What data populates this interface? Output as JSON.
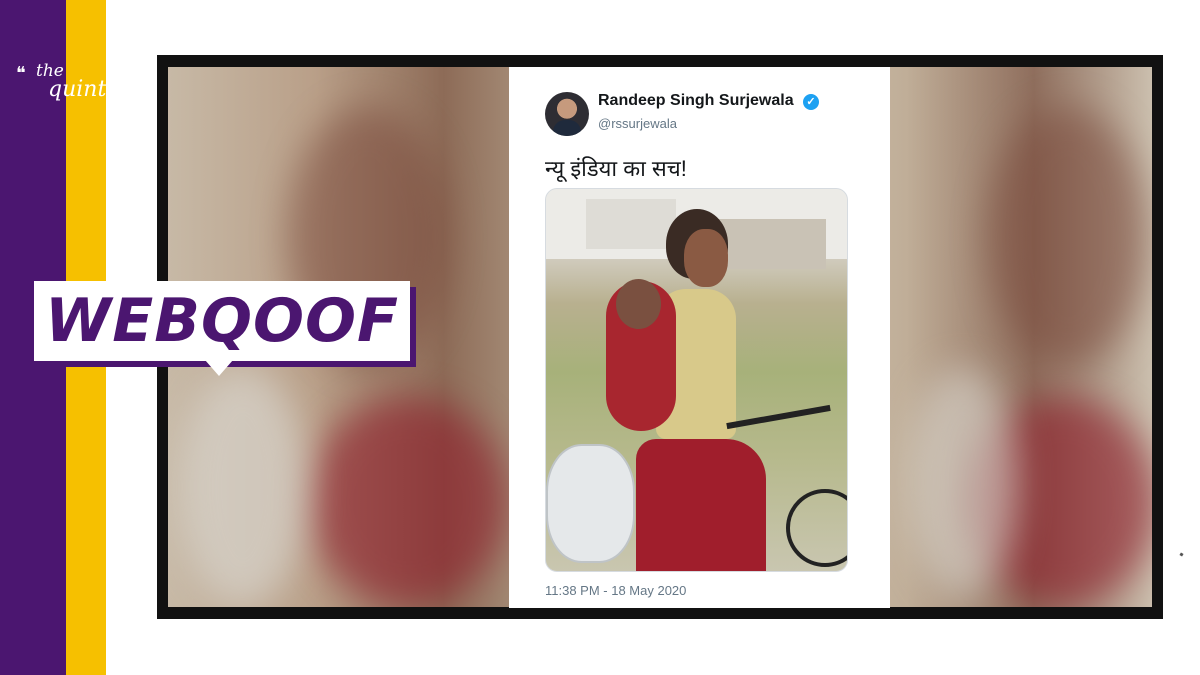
{
  "brand": {
    "logo_the": "the",
    "logo_quint": "quint",
    "purple": "#4b1670",
    "yellow": "#f6c000"
  },
  "badge": {
    "label": "WEBQOOF"
  },
  "tweet": {
    "author_name": "Randeep Singh Surjewala",
    "handle": "@rssurjewala",
    "verified_icon": "verified-badge-icon",
    "text": "न्यू इंडिया का सच!",
    "timestamp": "11:38 PM - 18 May 2020",
    "accent": "#1da1f2"
  }
}
